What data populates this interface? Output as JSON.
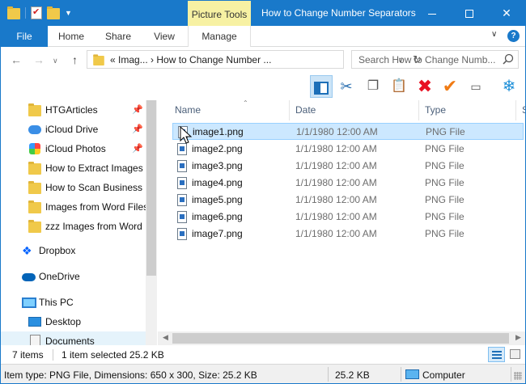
{
  "window": {
    "title": "How to Change Number Separators",
    "context_tab_label": "Picture Tools",
    "accent_color": "#1979ca"
  },
  "ribbon": {
    "tabs": [
      "File",
      "Home",
      "Share",
      "View",
      "Manage"
    ]
  },
  "address": {
    "path": "«  Imag... ›  How to Change Number ...",
    "search_placeholder": "Search How to Change Numb..."
  },
  "nav": {
    "items": [
      {
        "label": "HTGArticles",
        "icon": "folder-icon",
        "pinned": true
      },
      {
        "label": "iCloud Drive",
        "icon": "icloud-icon",
        "pinned": true
      },
      {
        "label": "iCloud Photos",
        "icon": "photos-icon",
        "pinned": true
      },
      {
        "label": "How to Extract Images f",
        "icon": "folder-icon",
        "pinned": false
      },
      {
        "label": "How to Scan Business C",
        "icon": "folder-icon",
        "pinned": false
      },
      {
        "label": "Images from Word Files",
        "icon": "folder-icon",
        "pinned": false
      },
      {
        "label": "zzz Images from Word I",
        "icon": "folder-icon",
        "pinned": false
      }
    ],
    "roots": [
      {
        "label": "Dropbox",
        "icon": "dropbox-icon"
      },
      {
        "label": "OneDrive",
        "icon": "onedrive-icon"
      },
      {
        "label": "This PC",
        "icon": "this-pc-icon"
      },
      {
        "label": "Desktop",
        "icon": "desktop-icon"
      },
      {
        "label": "Documents",
        "icon": "documents-icon"
      }
    ]
  },
  "columns": {
    "name": "Name",
    "date": "Date",
    "type": "Type",
    "size": "S"
  },
  "files": [
    {
      "name": "image1.png",
      "date": "1/1/1980 12:00 AM",
      "type": "PNG File",
      "selected": true
    },
    {
      "name": "image2.png",
      "date": "1/1/1980 12:00 AM",
      "type": "PNG File",
      "selected": false
    },
    {
      "name": "image3.png",
      "date": "1/1/1980 12:00 AM",
      "type": "PNG File",
      "selected": false
    },
    {
      "name": "image4.png",
      "date": "1/1/1980 12:00 AM",
      "type": "PNG File",
      "selected": false
    },
    {
      "name": "image5.png",
      "date": "1/1/1980 12:00 AM",
      "type": "PNG File",
      "selected": false
    },
    {
      "name": "image6.png",
      "date": "1/1/1980 12:00 AM",
      "type": "PNG File",
      "selected": false
    },
    {
      "name": "image7.png",
      "date": "1/1/1980 12:00 AM",
      "type": "PNG File",
      "selected": false
    }
  ],
  "status": {
    "items_count": "7 items",
    "selection": "1 item selected  25.2 KB"
  },
  "details_bar": {
    "info": "Item type: PNG File, Dimensions: 650 x 300, Size: 25.2 KB",
    "size": "25.2 KB",
    "location": "Computer"
  }
}
